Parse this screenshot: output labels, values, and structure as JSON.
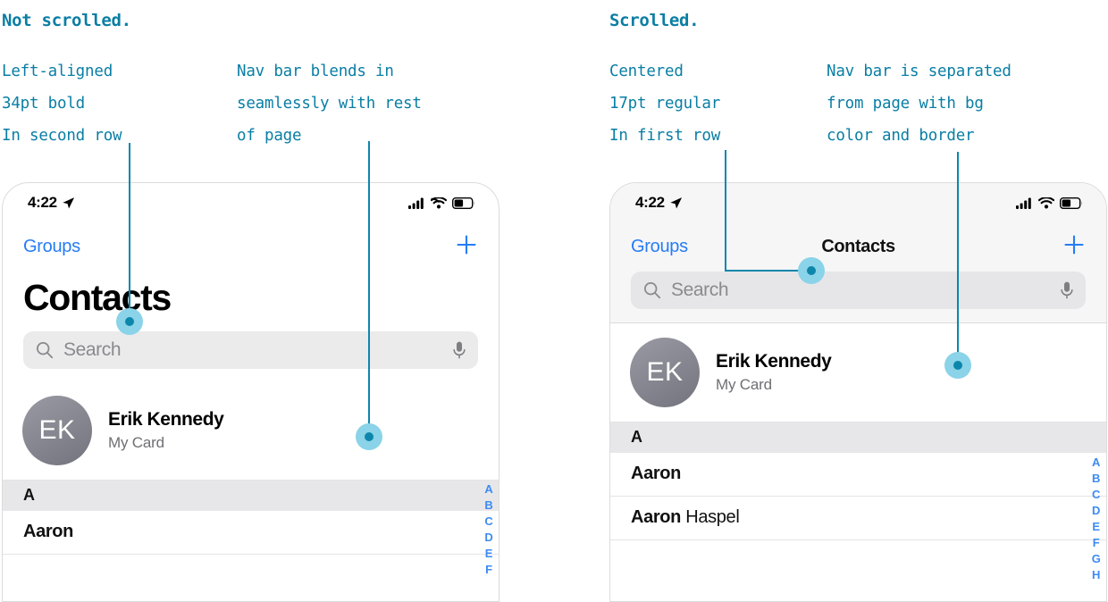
{
  "annotations": {
    "left": {
      "heading": "Not scrolled.",
      "note_a": "Left-aligned\n34pt bold\nIn second row",
      "note_b": "Nav bar blends in\nseamlessly with rest\nof page"
    },
    "right": {
      "heading": "Scrolled.",
      "note_a": "Centered\n17pt regular\nIn first row",
      "note_b": "Nav bar is separated\nfrom page with bg\ncolor and border"
    },
    "accent_color": "#0a7ea4",
    "dot_fill": "#8ad3e8",
    "dot_core": "#0d86ab"
  },
  "phone_left": {
    "status_bar": {
      "time": "4:22",
      "location_icon": "location-arrow-icon",
      "signal_icon": "cellular-bars-icon",
      "wifi_icon": "wifi-icon",
      "battery_icon": "battery-icon"
    },
    "nav_bar": {
      "back_label": "Groups",
      "title": "",
      "add_icon": "plus-icon"
    },
    "large_title": "Contacts",
    "search": {
      "placeholder": "Search",
      "search_icon": "search-icon",
      "dictate_icon": "microphone-icon"
    },
    "my_card": {
      "initials": "EK",
      "name": "Erik Kennedy",
      "subtitle": "My Card"
    },
    "sections": [
      {
        "header": "A",
        "rows": [
          {
            "bold": "Aaron",
            "regular": ""
          }
        ]
      }
    ],
    "alpha_index": [
      "A",
      "B",
      "C",
      "D",
      "E",
      "F"
    ]
  },
  "phone_right": {
    "status_bar": {
      "time": "4:22",
      "location_icon": "location-arrow-icon",
      "signal_icon": "cellular-bars-icon",
      "wifi_icon": "wifi-icon",
      "battery_icon": "battery-icon"
    },
    "nav_bar": {
      "back_label": "Groups",
      "title": "Contacts",
      "add_icon": "plus-icon"
    },
    "search": {
      "placeholder": "Search",
      "search_icon": "search-icon",
      "dictate_icon": "microphone-icon"
    },
    "my_card": {
      "initials": "EK",
      "name": "Erik Kennedy",
      "subtitle": "My Card"
    },
    "sections": [
      {
        "header": "A",
        "rows": [
          {
            "bold": "Aaron",
            "regular": ""
          },
          {
            "bold": "Aaron",
            "regular": " Haspel"
          }
        ]
      }
    ],
    "alpha_index": [
      "A",
      "B",
      "C",
      "D",
      "E",
      "F",
      "G",
      "H"
    ]
  }
}
